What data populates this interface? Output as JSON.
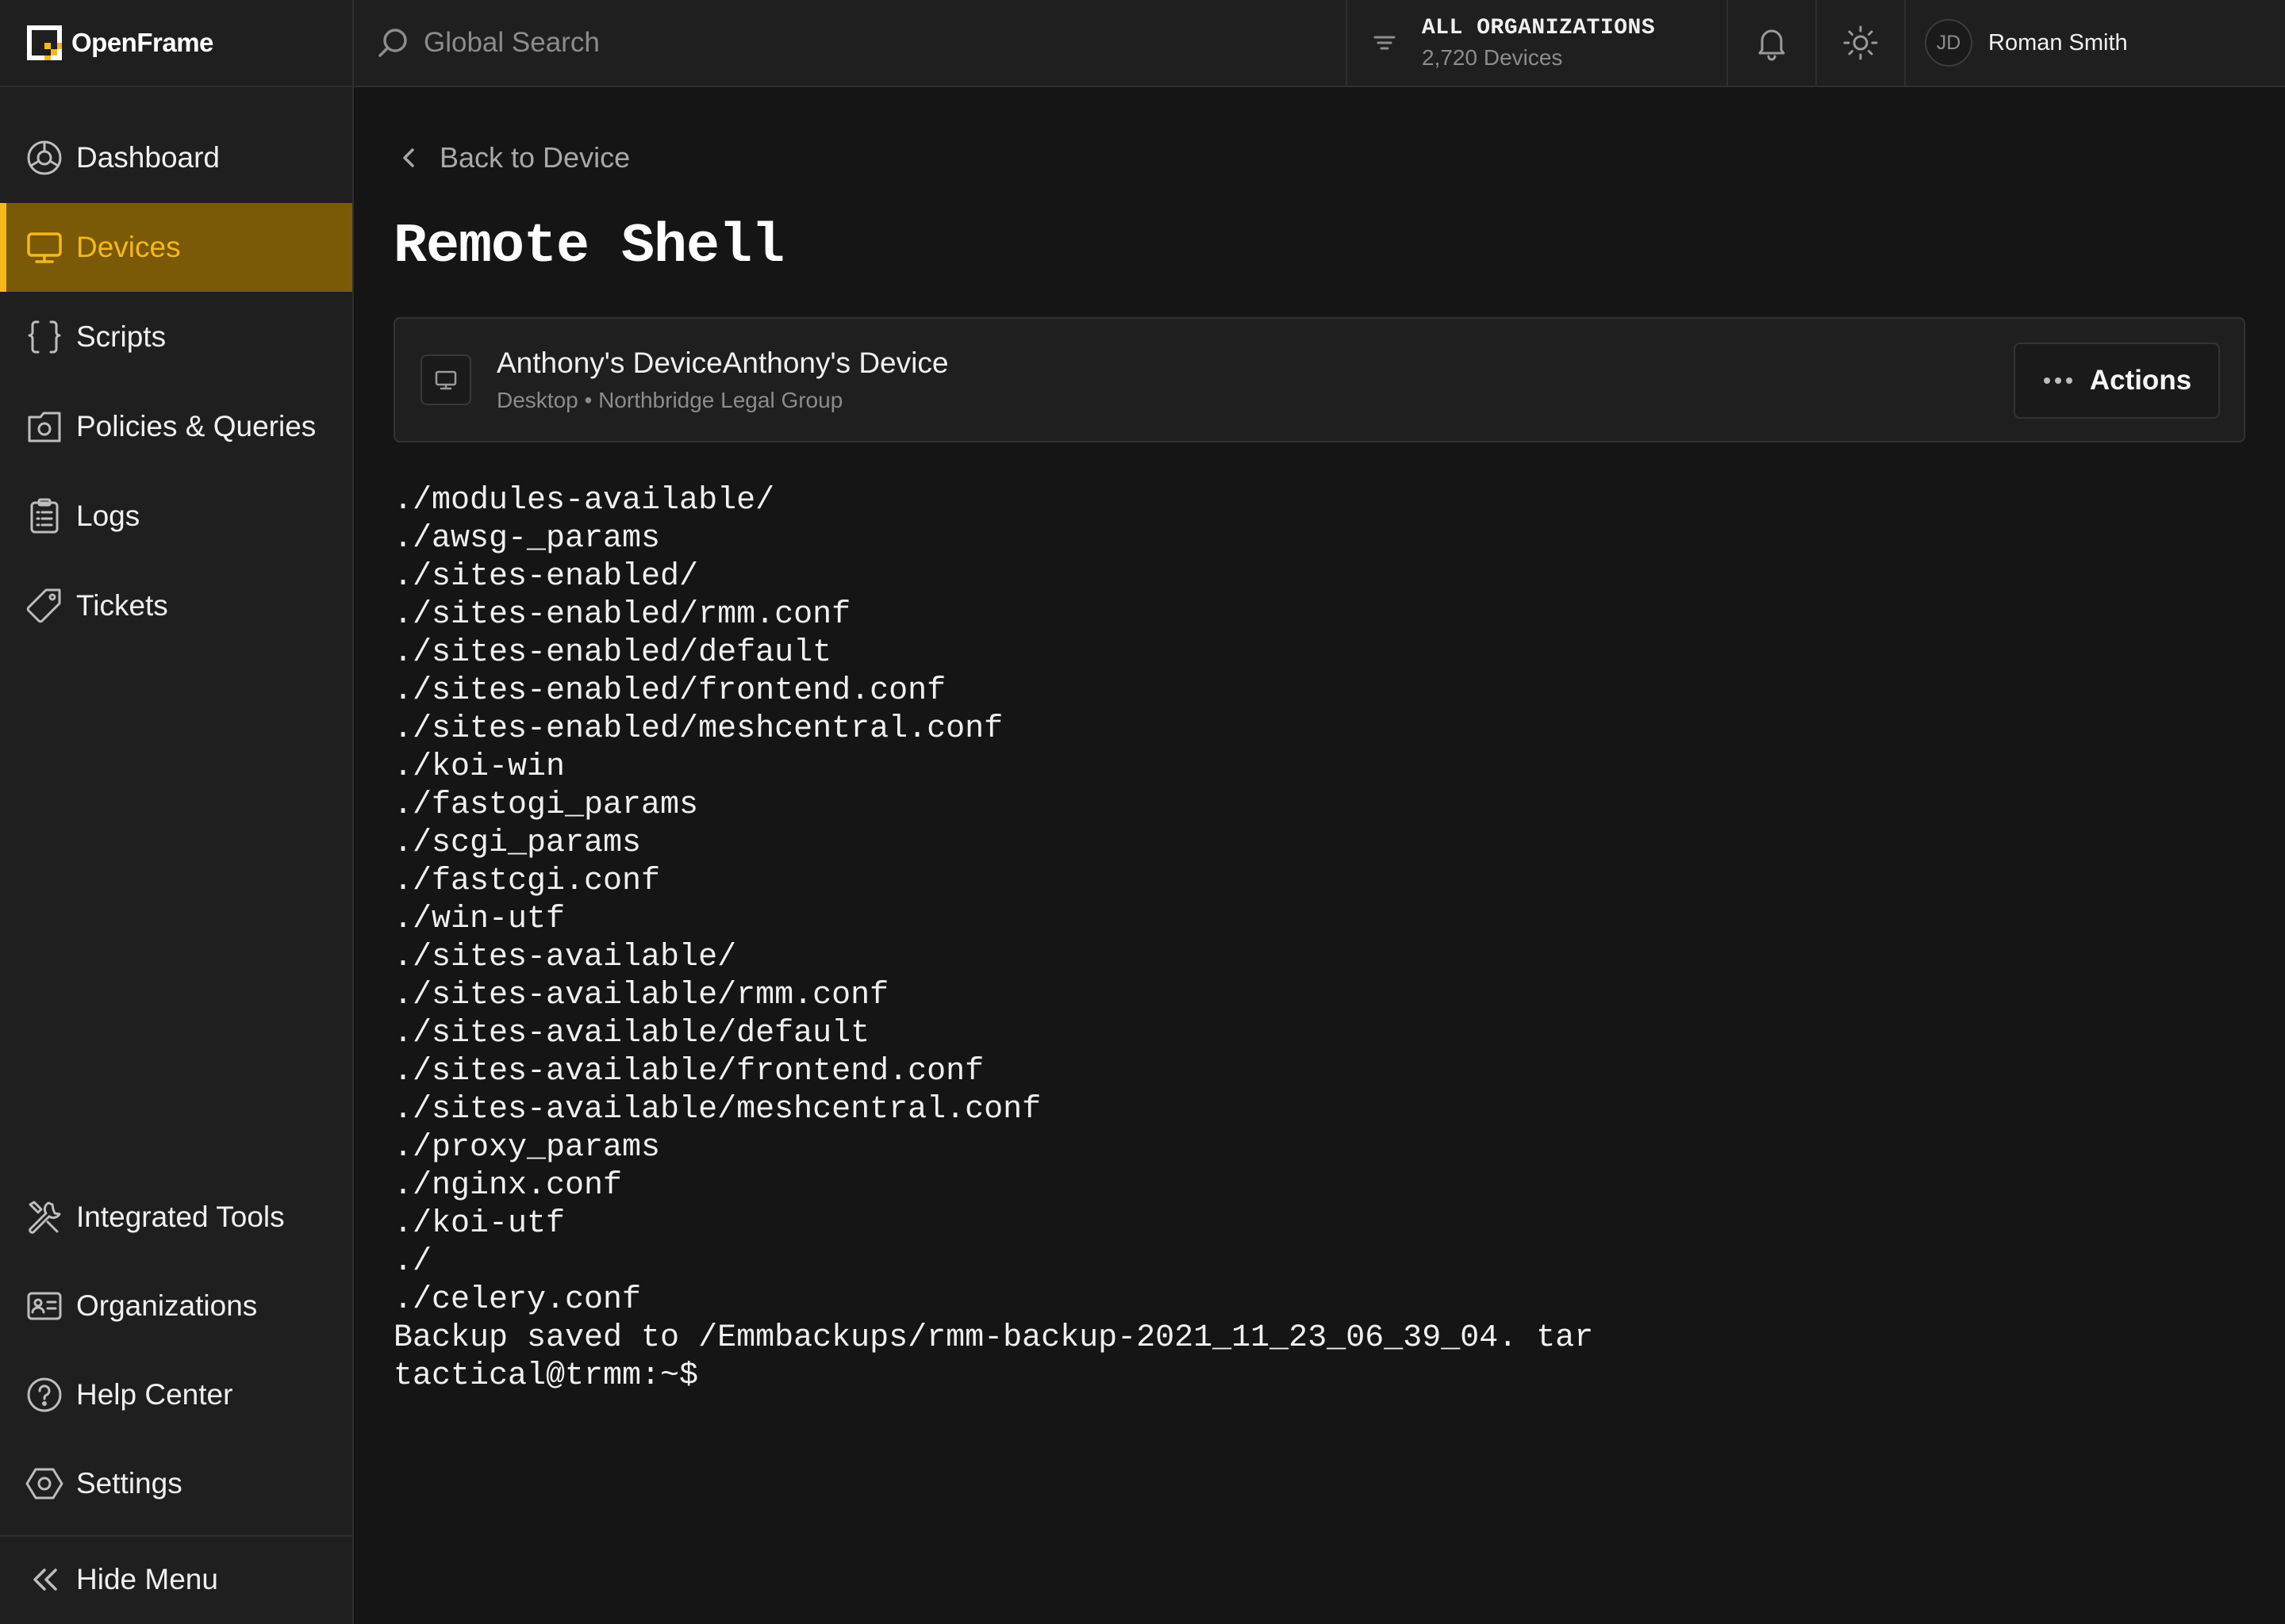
{
  "brand": {
    "name": "OpenFrame"
  },
  "search": {
    "placeholder": "Global Search"
  },
  "org_filter": {
    "title": "ALL ORGANIZATIONS",
    "count": "2,720 Devices"
  },
  "user": {
    "initials": "JD",
    "name": "Roman Smith"
  },
  "colors": {
    "accent": "#f5b819",
    "active_bg": "#7a5a06",
    "background": "#151515",
    "panel": "#1f1f1f"
  },
  "sidebar": {
    "items": [
      {
        "label": "Dashboard",
        "icon": "dashboard-icon"
      },
      {
        "label": "Devices",
        "icon": "monitor-icon",
        "active": true
      },
      {
        "label": "Scripts",
        "icon": "braces-icon"
      },
      {
        "label": "Policies & Queries",
        "icon": "policy-icon"
      },
      {
        "label": "Logs",
        "icon": "clipboard-icon"
      },
      {
        "label": "Tickets",
        "icon": "tag-icon"
      }
    ],
    "bottom_items": [
      {
        "label": "Integrated Tools",
        "icon": "tools-icon"
      },
      {
        "label": "Organizations",
        "icon": "id-card-icon"
      },
      {
        "label": "Help Center",
        "icon": "help-icon"
      },
      {
        "label": "Settings",
        "icon": "gear-icon"
      }
    ],
    "hide_menu": "Hide Menu"
  },
  "main": {
    "back_label": "Back to Device",
    "title": "Remote Shell",
    "device": {
      "name": "Anthony's DeviceAnthony's Device",
      "meta": "Desktop • Northbridge Legal Group"
    },
    "actions_label": "Actions",
    "terminal_lines": [
      "./modules-available/",
      "./awsg-_params",
      "./sites-enabled/",
      "./sites-enabled/rmm.conf",
      "./sites-enabled/default",
      "./sites-enabled/frontend.conf",
      "./sites-enabled/meshcentral.conf",
      "./koi-win",
      "./fastogi_params",
      "./scgi_params",
      "./fastcgi.conf",
      "./win-utf",
      "./sites-available/",
      "./sites-available/rmm.conf",
      "./sites-available/default",
      "./sites-available/frontend.conf",
      "./sites-available/meshcentral.conf",
      "./proxy_params",
      "./nginx.conf",
      "./koi-utf",
      "./",
      "./celery.conf",
      "Backup saved to /Emmbackups/rmm-backup-2021_11_23_06_39_04. tar",
      "tactical@trmm:~$"
    ]
  }
}
